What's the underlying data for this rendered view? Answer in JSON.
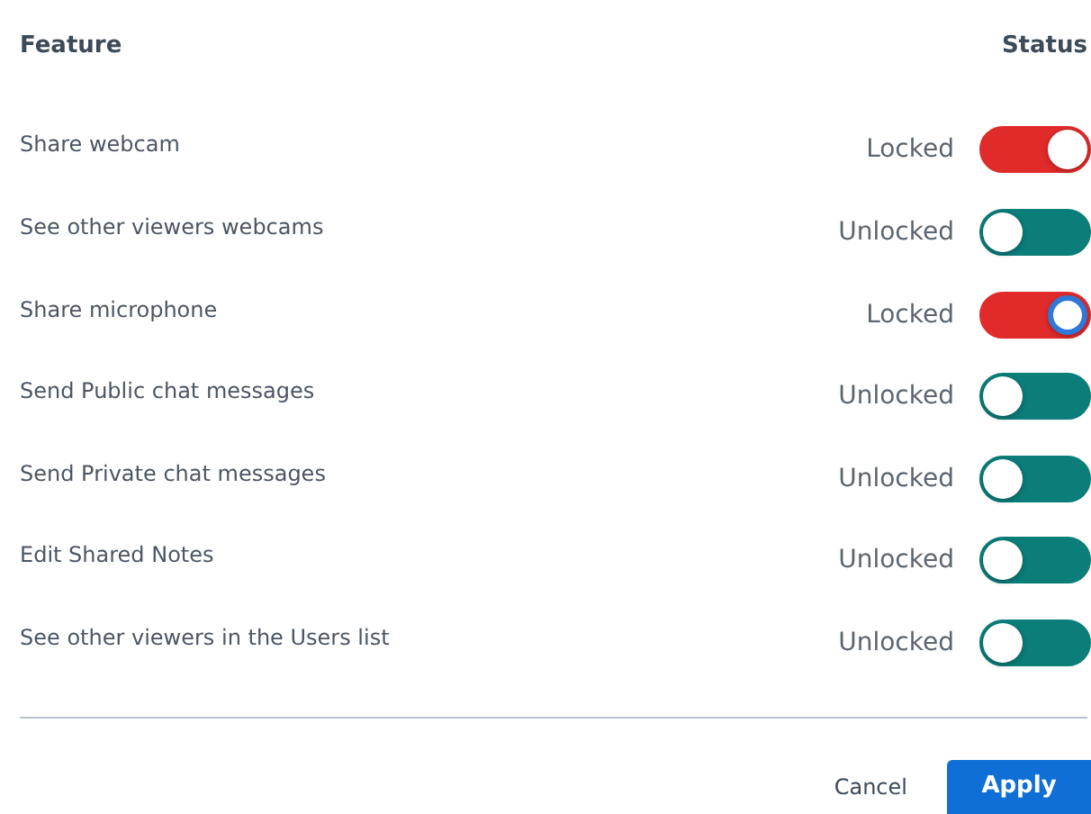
{
  "header": {
    "feature": "Feature",
    "status": "Status"
  },
  "features": [
    {
      "label": "Share webcam",
      "status": "Locked",
      "on": true,
      "focused": false
    },
    {
      "label": "See other viewers webcams",
      "status": "Unlocked",
      "on": false,
      "focused": false
    },
    {
      "label": "Share microphone",
      "status": "Locked",
      "on": true,
      "focused": true
    },
    {
      "label": "Send Public chat messages",
      "status": "Unlocked",
      "on": false,
      "focused": false
    },
    {
      "label": "Send Private chat messages",
      "status": "Unlocked",
      "on": false,
      "focused": false
    },
    {
      "label": "Edit Shared Notes",
      "status": "Unlocked",
      "on": false,
      "focused": false
    },
    {
      "label": "See other viewers in the Users list",
      "status": "Unlocked",
      "on": false,
      "focused": false
    }
  ],
  "buttons": {
    "cancel": "Cancel",
    "apply": "Apply"
  }
}
